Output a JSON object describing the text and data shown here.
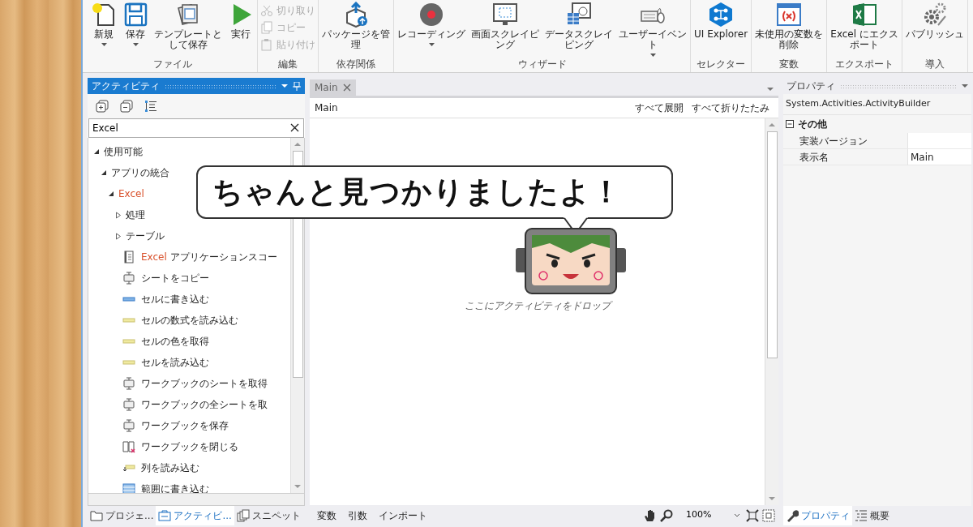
{
  "ribbon": {
    "groups": [
      {
        "label": "ファイル",
        "kind": "large",
        "buttons": [
          {
            "kind": "new",
            "label": "新規",
            "dropdown": true
          },
          {
            "kind": "save",
            "label": "保存",
            "dropdown": true
          },
          {
            "kind": "template",
            "label": "テンプレートとして保存",
            "dropdown": false
          },
          {
            "kind": "run",
            "label": "実行",
            "dropdown": false
          }
        ]
      },
      {
        "label": "編集",
        "kind": "stack",
        "buttons": [
          {
            "kind": "cut",
            "label": "切り取り",
            "disabled": true
          },
          {
            "kind": "copy",
            "label": "コピー",
            "disabled": true
          },
          {
            "kind": "paste",
            "label": "貼り付け",
            "disabled": true
          }
        ]
      },
      {
        "label": "依存関係",
        "kind": "large",
        "buttons": [
          {
            "kind": "packages",
            "label": "パッケージを管理",
            "dropdown": false
          }
        ]
      },
      {
        "label": "ウィザード",
        "kind": "large",
        "buttons": [
          {
            "kind": "record",
            "label": "レコーディング",
            "dropdown": true
          },
          {
            "kind": "screen",
            "label": "画面スクレイピング",
            "dropdown": false
          },
          {
            "kind": "data",
            "label": "データスクレイピング",
            "dropdown": false
          },
          {
            "kind": "events",
            "label": "ユーザーイベント",
            "dropdown": true
          }
        ]
      },
      {
        "label": "セレクター",
        "kind": "large",
        "buttons": [
          {
            "kind": "explorer",
            "label": "UI Explorer",
            "dropdown": false
          }
        ]
      },
      {
        "label": "変数",
        "kind": "large",
        "buttons": [
          {
            "kind": "variables",
            "label": "未使用の変数を削除",
            "dropdown": false
          }
        ]
      },
      {
        "label": "エクスポート",
        "kind": "large",
        "buttons": [
          {
            "kind": "export",
            "label": "Excel にエクスポート",
            "dropdown": false
          }
        ]
      },
      {
        "label": "導入",
        "kind": "large",
        "buttons": [
          {
            "kind": "publish",
            "label": "パブリッシュ",
            "dropdown": false
          }
        ]
      }
    ]
  },
  "activities_panel": {
    "title": "アクティビティ",
    "search": {
      "value": "Excel"
    },
    "tree": [
      {
        "kind": "group",
        "expanded": true,
        "parts": [
          {
            "text": "使用可能",
            "match": false
          }
        ],
        "children": [
          {
            "kind": "group",
            "expanded": true,
            "parts": [
              {
                "text": "アプリの統合",
                "match": false
              }
            ],
            "children": [
              {
                "kind": "group",
                "expanded": true,
                "parts": [
                  {
                    "text": "Excel",
                    "match": true
                  }
                ],
                "children": [
                  {
                    "kind": "group",
                    "expanded": false,
                    "parts": [
                      {
                        "text": "処理",
                        "match": false
                      }
                    ]
                  },
                  {
                    "kind": "group",
                    "expanded": false,
                    "parts": [
                      {
                        "text": "テーブル",
                        "match": false
                      }
                    ]
                  },
                  {
                    "kind": "scope",
                    "parts": [
                      {
                        "text": "Excel",
                        "match": true
                      },
                      {
                        "text": "アプリケーションスコー",
                        "match": false
                      }
                    ]
                  },
                  {
                    "kind": "sheet",
                    "parts": [
                      {
                        "text": "シートをコピー",
                        "match": false
                      }
                    ]
                  },
                  {
                    "kind": "write",
                    "parts": [
                      {
                        "text": "セルに書き込む",
                        "match": false
                      }
                    ]
                  },
                  {
                    "kind": "read",
                    "parts": [
                      {
                        "text": "セルの数式を読み込む",
                        "match": false
                      }
                    ]
                  },
                  {
                    "kind": "read",
                    "parts": [
                      {
                        "text": "セルの色を取得",
                        "match": false
                      }
                    ]
                  },
                  {
                    "kind": "read",
                    "parts": [
                      {
                        "text": "セルを読み込む",
                        "match": false
                      }
                    ]
                  },
                  {
                    "kind": "sheet",
                    "parts": [
                      {
                        "text": "ワークブックのシートを取得",
                        "match": false
                      }
                    ]
                  },
                  {
                    "kind": "sheet",
                    "parts": [
                      {
                        "text": "ワークブックの全シートを取",
                        "match": false
                      }
                    ]
                  },
                  {
                    "kind": "sheet",
                    "parts": [
                      {
                        "text": "ワークブックを保存",
                        "match": false
                      }
                    ]
                  },
                  {
                    "kind": "close",
                    "parts": [
                      {
                        "text": "ワークブックを閉じる",
                        "match": false
                      }
                    ]
                  },
                  {
                    "kind": "column",
                    "parts": [
                      {
                        "text": "列を読み込む",
                        "match": false
                      }
                    ]
                  },
                  {
                    "kind": "range",
                    "parts": [
                      {
                        "text": "範囲に書き込む",
                        "match": false
                      }
                    ]
                  }
                ]
              }
            ]
          }
        ]
      }
    ],
    "tabs": [
      {
        "kind": "folder",
        "label": "プロジェ...",
        "selected": false
      },
      {
        "kind": "activities",
        "label": "アクティビ...",
        "selected": true
      },
      {
        "kind": "snippets",
        "label": "スニペット",
        "selected": false
      }
    ]
  },
  "designer": {
    "tabs": [
      {
        "label": "Main",
        "selected": true
      }
    ],
    "title": "Main",
    "actions": [
      "すべて展開",
      "すべて折りたたみ"
    ],
    "drop_hint": "ここにアクティビティをドロップ",
    "bottom_tabs": [
      "変数",
      "引数",
      "インポート"
    ],
    "zoom": "100%"
  },
  "properties": {
    "title": "プロパティ",
    "type_name": "System.Activities.ActivityBuilder",
    "categories": [
      {
        "label": "その他",
        "expanded": true,
        "rows": [
          {
            "name": "実装バージョン"
          },
          {
            "name": "表示名",
            "value": "Main"
          }
        ]
      }
    ],
    "tabs": [
      {
        "kind": "properties",
        "label": "プロパティ",
        "selected": true
      },
      {
        "kind": "outline",
        "label": "概要",
        "selected": false
      }
    ]
  },
  "overlay": {
    "bubble": "ちゃんと見つかりましたよ！"
  }
}
